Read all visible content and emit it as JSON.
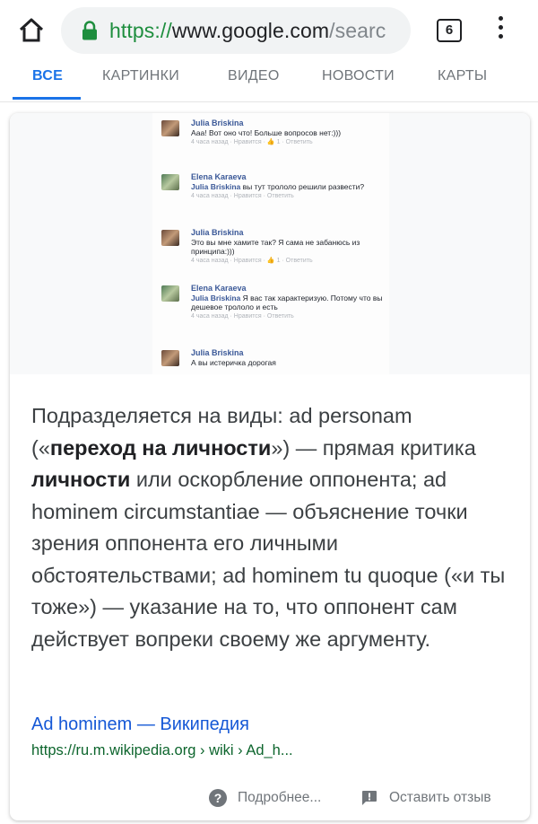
{
  "browser": {
    "url_scheme": "https://",
    "url_host": "www.google.com",
    "url_path": "/searc",
    "tab_count": "6"
  },
  "nav": {
    "tabs": [
      "ВСЕ",
      "КАРТИНКИ",
      "ВИДЕО",
      "НОВОСТИ",
      "КАРТЫ"
    ]
  },
  "image_comments": [
    {
      "name": "Julia Briskina",
      "text": "Ааа! Вот оно что! Больше вопросов нет:)))",
      "mention": "",
      "meta": "4 часа назад · Нравится · 👍 1 · Ответить"
    },
    {
      "name": "Elena Karaeva",
      "mention": "Julia Briskina",
      "text": " вы тут трололо решили развести?",
      "meta": "4 часа назад · Нравится · Ответить"
    },
    {
      "name": "Julia Briskina",
      "text": "Это вы мне хамите так? Я сама не забанюсь из принципа:)))",
      "mention": "",
      "meta": "4 часа назад · Нравится · 👍 1 · Ответить"
    },
    {
      "name": "Elena Karaeva",
      "mention": "Julia Briskina",
      "text": " Я вас так характеризую. Потому что вы дешевое трололо и есть",
      "meta": "4 часа назад · Нравится · Ответить"
    },
    {
      "name": "Julia Briskina",
      "text": "А вы истеричка дорогая",
      "mention": "",
      "meta": ""
    }
  ],
  "snippet": {
    "part1": "Подразделяется на виды: ad personam («",
    "bold1": "переход на личности",
    "part2": "») — прямая критика ",
    "bold2": "личности",
    "part3": " или оскорбление оппонента; ad hominem circumstantiae — объяснение точки зрения оппонента его личными обстоятельствами; ad hominem tu quoque («и ты тоже») — указание на то, что оппонент сам действует вопреки своему же аргументу."
  },
  "source": {
    "title": "Ad hominem — Википедия",
    "url": "https://ru.m.wikipedia.org › wiki › Ad_h..."
  },
  "footer": {
    "more_label": "Подробнее...",
    "feedback_label": "Оставить отзыв"
  },
  "colors": {
    "accent": "#1a73e8",
    "link": "#1558d6",
    "url_green": "#0d652d",
    "secure_green": "#1e8e3e"
  }
}
